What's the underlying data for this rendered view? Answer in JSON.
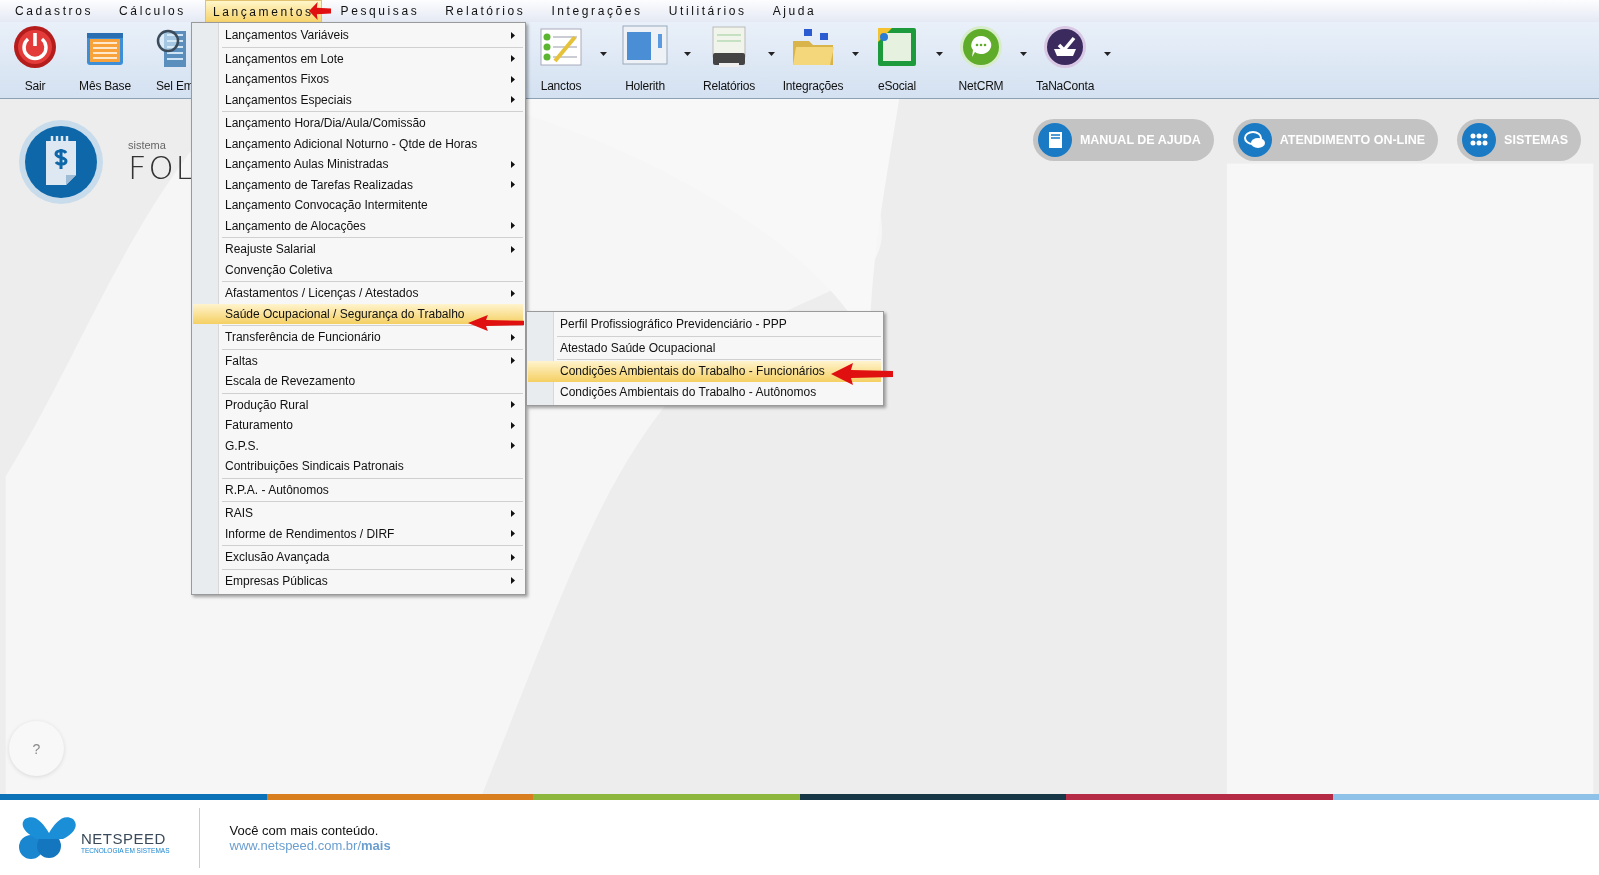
{
  "menubar": [
    {
      "label": "Cadastros",
      "selected": false
    },
    {
      "label": "Cálculos",
      "selected": false
    },
    {
      "label": "Lançamentos",
      "selected": true
    },
    {
      "label": "Pesquisas",
      "selected": false
    },
    {
      "label": "Relatórios",
      "selected": false
    },
    {
      "label": "Integrações",
      "selected": false
    },
    {
      "label": "Utilitários",
      "selected": false
    },
    {
      "label": "Ajuda",
      "selected": false
    }
  ],
  "toolbar": [
    {
      "label": "Sair",
      "dropdown": false
    },
    {
      "label": "Mês Base",
      "dropdown": false
    },
    {
      "label": "Sel Em",
      "dropdown": false
    },
    {
      "label": "Lanctos",
      "dropdown": true
    },
    {
      "label": "Holerith",
      "dropdown": true
    },
    {
      "label": "Relatórios",
      "dropdown": true
    },
    {
      "label": "Integrações",
      "dropdown": true
    },
    {
      "label": "eSocial",
      "dropdown": true
    },
    {
      "label": "NetCRM",
      "dropdown": true
    },
    {
      "label": "TaNaConta",
      "dropdown": true
    }
  ],
  "brand": {
    "caption": "sistema",
    "name": "FOL"
  },
  "header_buttons": [
    "MANUAL DE AJUDA",
    "ATENDIMENTO ON-LINE",
    "SISTEMAS"
  ],
  "menu": {
    "groups": [
      [
        {
          "label": "Lançamentos Variáveis",
          "submenu": true,
          "selected": false
        }
      ],
      [
        {
          "label": "Lançamentos em Lote",
          "submenu": true,
          "selected": false
        },
        {
          "label": "Lançamentos Fixos",
          "submenu": true,
          "selected": false
        },
        {
          "label": "Lançamentos Especiais",
          "submenu": true,
          "selected": false
        }
      ],
      [
        {
          "label": "Lançamento Hora/Dia/Aula/Comissão",
          "submenu": false,
          "selected": false
        },
        {
          "label": "Lançamento Adicional Noturno - Qtde de Horas",
          "submenu": false,
          "selected": false
        },
        {
          "label": "Lançamento Aulas Ministradas",
          "submenu": true,
          "selected": false
        },
        {
          "label": "Lançamento de Tarefas Realizadas",
          "submenu": true,
          "selected": false
        },
        {
          "label": "Lançamento Convocação Intermitente",
          "submenu": false,
          "selected": false
        },
        {
          "label": "Lançamento de Alocações",
          "submenu": true,
          "selected": false
        }
      ],
      [
        {
          "label": "Reajuste Salarial",
          "submenu": true,
          "selected": false
        },
        {
          "label": "Convenção Coletiva",
          "submenu": false,
          "selected": false
        }
      ],
      [
        {
          "label": "Afastamentos / Licenças / Atestados",
          "submenu": true,
          "selected": false
        },
        {
          "label": "Saúde Ocupacional / Segurança do Trabalho",
          "submenu": false,
          "selected": true
        }
      ],
      [
        {
          "label": "Transferência de Funcionário",
          "submenu": true,
          "selected": false
        }
      ],
      [
        {
          "label": "Faltas",
          "submenu": true,
          "selected": false
        },
        {
          "label": "Escala de Revezamento",
          "submenu": false,
          "selected": false
        }
      ],
      [
        {
          "label": "Produção Rural",
          "submenu": true,
          "selected": false
        },
        {
          "label": "Faturamento",
          "submenu": true,
          "selected": false
        },
        {
          "label": "G.P.S.",
          "submenu": true,
          "selected": false
        },
        {
          "label": "Contribuições Sindicais Patronais",
          "submenu": false,
          "selected": false
        }
      ],
      [
        {
          "label": "R.P.A. - Autônomos",
          "submenu": false,
          "selected": false
        }
      ],
      [
        {
          "label": "RAIS",
          "submenu": true,
          "selected": false
        },
        {
          "label": "Informe de Rendimentos / DIRF",
          "submenu": true,
          "selected": false
        }
      ],
      [
        {
          "label": "Exclusão Avançada",
          "submenu": true,
          "selected": false
        }
      ],
      [
        {
          "label": "Empresas Públicas",
          "submenu": true,
          "selected": false
        }
      ]
    ]
  },
  "submenu": {
    "groups": [
      [
        {
          "label": "Perfil Profissiográfico Previdenciário - PPP",
          "selected": false
        }
      ],
      [
        {
          "label": "Atestado Saúde Ocupacional",
          "selected": false
        }
      ],
      [
        {
          "label": "Condições Ambientais do Trabalho - Funcionários",
          "selected": true
        },
        {
          "label": "Condições Ambientais do Trabalho - Autônomos",
          "selected": false
        }
      ]
    ]
  },
  "help_button": "?",
  "footer": {
    "company": "NETSPEED",
    "tagline": "TECNOLOGIA EM SISTEMAS",
    "message": "Você com mais conteúdo.",
    "link": "www.netspeed.com.br/**mais**"
  }
}
